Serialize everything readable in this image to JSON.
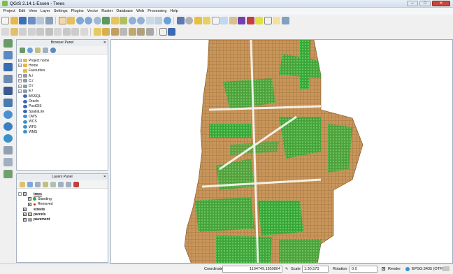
{
  "window": {
    "title": "QGIS 2.14.1-Essen - Trees"
  },
  "menu": [
    "Project",
    "Edit",
    "View",
    "Layer",
    "Settings",
    "Plugins",
    "Vector",
    "Raster",
    "Database",
    "Web",
    "Processing",
    "Help"
  ],
  "browser_panel": {
    "title": "Browser Panel",
    "items": [
      "Project home",
      "Home",
      "Favourites",
      "A:/",
      "C:/",
      "D:/",
      "E:/",
      "MSSQL",
      "Oracle",
      "PostGIS",
      "SpatiaLite",
      "OWS",
      "WCS",
      "WFS",
      "WMS"
    ]
  },
  "layers_panel": {
    "title": "Layers Panel",
    "layers": [
      {
        "name": "trees",
        "sub": [
          "Standing",
          "Removed"
        ]
      },
      {
        "name": "streets"
      },
      {
        "name": "parcels"
      },
      {
        "name": "pavement"
      }
    ]
  },
  "status": {
    "coordinate_label": "Coordinate",
    "coordinate_value": "1104749,1859804",
    "scale_label": "Scale",
    "scale_value": "1:30,570",
    "rotation_label": "Rotation",
    "rotation_value": "0.0",
    "render_label": "Render",
    "crs": "EPSG:3435 (OTF)"
  },
  "colors": {
    "parcels": "#c8955a",
    "trees": "#3aa53a",
    "pavement": "#9aa0a6"
  }
}
